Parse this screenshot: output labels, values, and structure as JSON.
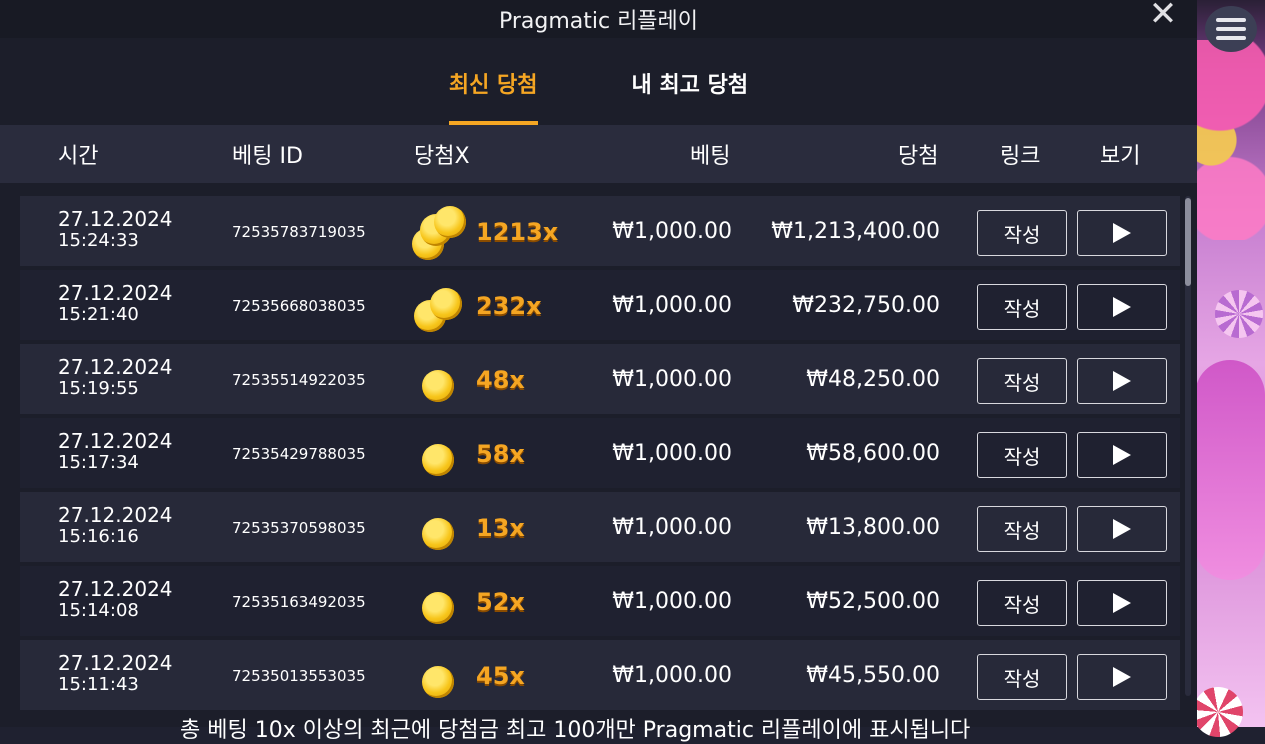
{
  "window": {
    "title": "Pragmatic 리플레이"
  },
  "tabs": [
    {
      "label": "최신 당첨",
      "active": true
    },
    {
      "label": "내 최고 당첨",
      "active": false
    }
  ],
  "columns": {
    "time": "시간",
    "bet_id": "베팅 ID",
    "multiplier": "당첨X",
    "bet": "베팅",
    "win": "당첨",
    "link": "링크",
    "view": "보기"
  },
  "rows": [
    {
      "date": "27.12.2024",
      "time": "15:24:33",
      "bet_id": "72535783719035",
      "coins": 3,
      "multiplier": "1213x",
      "bet": "₩1,000.00",
      "win": "₩1,213,400.00",
      "link_label": "작성"
    },
    {
      "date": "27.12.2024",
      "time": "15:21:40",
      "bet_id": "72535668038035",
      "coins": 2,
      "multiplier": "232x",
      "bet": "₩1,000.00",
      "win": "₩232,750.00",
      "link_label": "작성"
    },
    {
      "date": "27.12.2024",
      "time": "15:19:55",
      "bet_id": "72535514922035",
      "coins": 1,
      "multiplier": "48x",
      "bet": "₩1,000.00",
      "win": "₩48,250.00",
      "link_label": "작성"
    },
    {
      "date": "27.12.2024",
      "time": "15:17:34",
      "bet_id": "72535429788035",
      "coins": 1,
      "multiplier": "58x",
      "bet": "₩1,000.00",
      "win": "₩58,600.00",
      "link_label": "작성"
    },
    {
      "date": "27.12.2024",
      "time": "15:16:16",
      "bet_id": "72535370598035",
      "coins": 1,
      "multiplier": "13x",
      "bet": "₩1,000.00",
      "win": "₩13,800.00",
      "link_label": "작성"
    },
    {
      "date": "27.12.2024",
      "time": "15:14:08",
      "bet_id": "72535163492035",
      "coins": 1,
      "multiplier": "52x",
      "bet": "₩1,000.00",
      "win": "₩52,500.00",
      "link_label": "작성"
    },
    {
      "date": "27.12.2024",
      "time": "15:11:43",
      "bet_id": "72535013553035",
      "coins": 1,
      "multiplier": "45x",
      "bet": "₩1,000.00",
      "win": "₩45,550.00",
      "link_label": "작성"
    }
  ],
  "footer": {
    "note": "총 베팅 10x 이상의 최근에 당첨금 최고 100개만 Pragmatic 리플레이에 표시됩니다"
  },
  "icons": {
    "close": "close-icon",
    "menu": "menu-icon",
    "play": "play-icon",
    "coin": "coin-icon"
  },
  "colors": {
    "accent": "#f5a623",
    "background": "#1c1e2a",
    "row": "#272939"
  }
}
